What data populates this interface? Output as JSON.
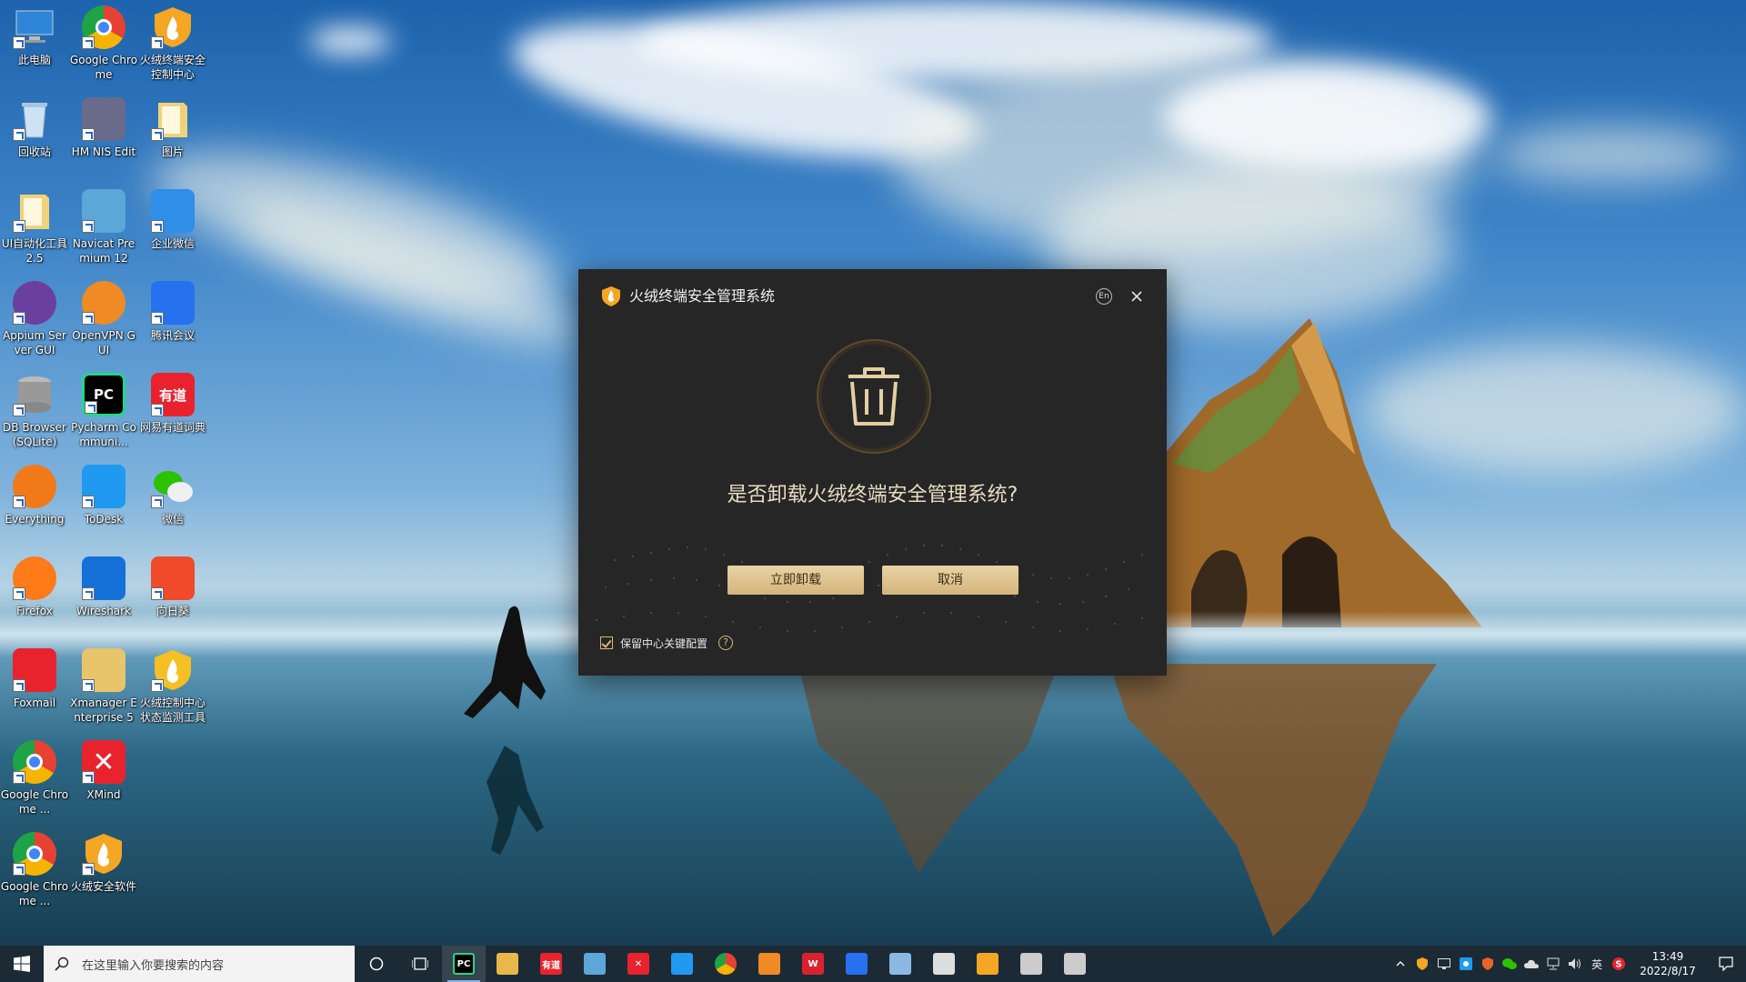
{
  "desktop": {
    "icons": [
      {
        "label": "此电脑",
        "icon": "this-pc-icon",
        "color": "#3b8fd8"
      },
      {
        "label": "Google Chrome",
        "icon": "chrome-icon",
        "color": "#e54234"
      },
      {
        "label": "火绒终端安全控制中心",
        "icon": "huorong-control-icon",
        "color": "#f5a623"
      },
      {
        "label": "回收站",
        "icon": "recycle-bin-icon",
        "color": "#a8c6e0"
      },
      {
        "label": "HM NIS Edit",
        "icon": "nsis-icon",
        "color": "#6a6a8a"
      },
      {
        "label": "图片",
        "icon": "pictures-folder-icon",
        "color": "#e8c46a"
      },
      {
        "label": "UI自动化工具2.5",
        "icon": "folder-icon",
        "color": "#e8c46a"
      },
      {
        "label": "Navicat Premium 12",
        "icon": "navicat-icon",
        "color": "#5aa7d8"
      },
      {
        "label": "企业微信",
        "icon": "wecom-icon",
        "color": "#2e8ee8"
      },
      {
        "label": "Appium Server GUI",
        "icon": "appium-icon",
        "color": "#6b3fa0"
      },
      {
        "label": "OpenVPN GUI",
        "icon": "openvpn-icon",
        "color": "#f08a24"
      },
      {
        "label": "腾讯会议",
        "icon": "tencent-meeting-icon",
        "color": "#2671f0"
      },
      {
        "label": "DB Browser (SQLite)",
        "icon": "database-icon",
        "color": "#8a8a8a"
      },
      {
        "label": "Pycharm Communi...",
        "icon": "pycharm-icon",
        "color": "#21d789"
      },
      {
        "label": "网易有道词典",
        "icon": "youdao-icon",
        "color": "#e8232e"
      },
      {
        "label": "Everything",
        "icon": "everything-search-icon",
        "color": "#f07a1a"
      },
      {
        "label": "ToDesk",
        "icon": "todesk-icon",
        "color": "#1f9af0"
      },
      {
        "label": "微信",
        "icon": "wechat-icon",
        "color": "#2dc100"
      },
      {
        "label": "Firefox",
        "icon": "firefox-icon",
        "color": "#ff7a18"
      },
      {
        "label": "Wireshark",
        "icon": "wireshark-icon",
        "color": "#1570d8"
      },
      {
        "label": "向日葵",
        "icon": "sunlogin-icon",
        "color": "#f04a2a"
      },
      {
        "label": "Foxmail",
        "icon": "foxmail-icon",
        "color": "#e8232e"
      },
      {
        "label": "Xmanager Enterprise 5",
        "icon": "xmanager-icon",
        "color": "#e8c46a"
      },
      {
        "label": "火绒控制中心状态监测工具",
        "icon": "huorong-monitor-icon",
        "color": "#f5c023"
      },
      {
        "label": "Google Chrome ...",
        "icon": "chrome-beta-icon",
        "color": "#e54234"
      },
      {
        "label": "XMind",
        "icon": "xmind-icon",
        "color": "#e8232e"
      },
      {
        "label": "",
        "icon": "",
        "color": ""
      },
      {
        "label": "Google Chrome ...",
        "icon": "chrome-dev-icon",
        "color": "#e54234"
      },
      {
        "label": "火绒安全软件",
        "icon": "huorong-security-icon",
        "color": "#f5a623"
      }
    ]
  },
  "dialog": {
    "title": "火绒终端安全管理系统",
    "lang_button": "En",
    "question": "是否卸载火绒终端安全管理系统?",
    "uninstall_label": "立即卸载",
    "cancel_label": "取消",
    "keep_config_label": "保留中心关键配置",
    "keep_config_checked": true,
    "help_glyph": "?",
    "accent_color": "#d9b778"
  },
  "taskbar": {
    "search_placeholder": "在这里输入你要搜索的内容",
    "pinned": [
      {
        "name": "pycharm",
        "icon": "pycharm-icon",
        "color": "#21d789",
        "text": "PC",
        "active": true
      },
      {
        "name": "file-explorer",
        "icon": "folder-icon",
        "color": "#e8b84a",
        "text": "",
        "active": false
      },
      {
        "name": "youdao",
        "icon": "youdao-icon",
        "color": "#e8232e",
        "text": "有道",
        "active": false
      },
      {
        "name": "navicat",
        "icon": "navicat-icon",
        "color": "#5aa7d8",
        "text": "",
        "active": false
      },
      {
        "name": "xmind",
        "icon": "xmind-icon",
        "color": "#e8232e",
        "text": "✕",
        "active": false
      },
      {
        "name": "todesk",
        "icon": "todesk-icon",
        "color": "#1f9af0",
        "text": "",
        "active": false
      },
      {
        "name": "chrome",
        "icon": "chrome-icon",
        "color": "#e54234",
        "text": "",
        "active": false
      },
      {
        "name": "orange-app",
        "icon": "app-icon",
        "color": "#f08a24",
        "text": "",
        "active": false
      },
      {
        "name": "wps",
        "icon": "wps-icon",
        "color": "#d8232e",
        "text": "W",
        "active": false
      },
      {
        "name": "blue-app",
        "icon": "app-icon",
        "color": "#2671f0",
        "text": "",
        "active": false
      },
      {
        "name": "notepad",
        "icon": "notepad-icon",
        "color": "#8bb8e0",
        "text": "",
        "active": false
      },
      {
        "name": "window-app",
        "icon": "window-icon",
        "color": "#dddddd",
        "text": "",
        "active": false
      },
      {
        "name": "huorong",
        "icon": "huorong-icon",
        "color": "#f5a623",
        "text": "",
        "active": false
      },
      {
        "name": "user-app",
        "icon": "user-icon",
        "color": "#cccccc",
        "text": "",
        "active": false
      },
      {
        "name": "recycle-app",
        "icon": "recycle-icon",
        "color": "#cccccc",
        "text": "",
        "active": false
      }
    ],
    "tray": {
      "ime": "英",
      "time": "13:49",
      "date": "2022/8/17"
    }
  }
}
